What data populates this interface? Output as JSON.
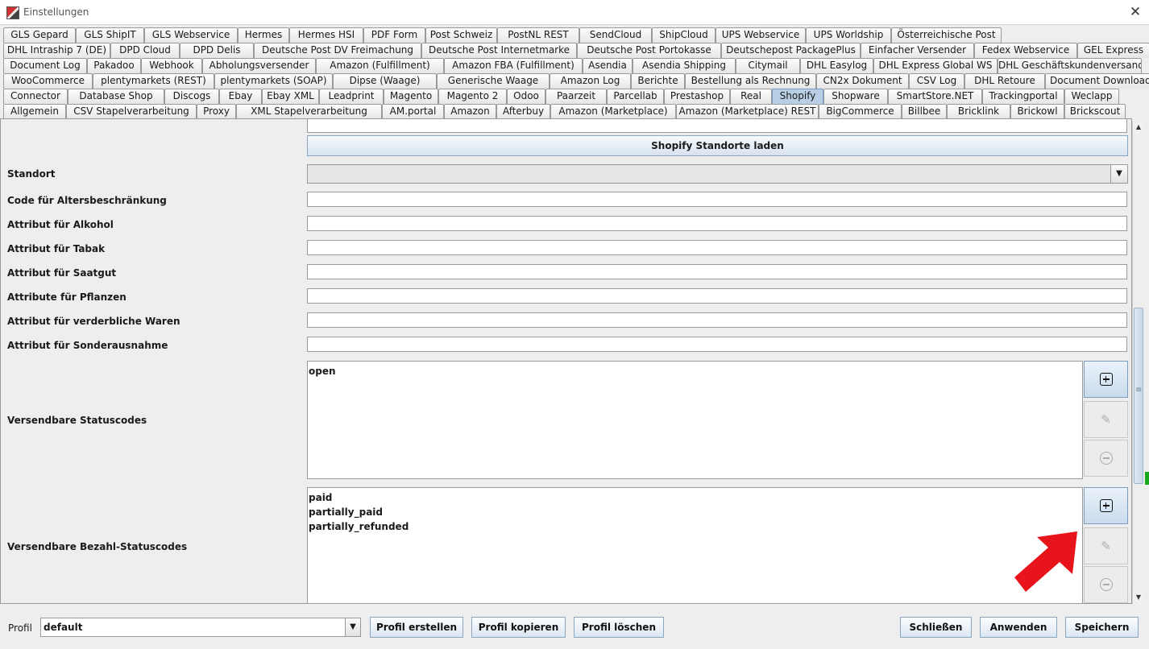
{
  "window": {
    "title": "Einstellungen"
  },
  "tab_rows": [
    [
      "GLS Gepard",
      "GLS ShipIT",
      "GLS Webservice",
      "Hermes",
      "Hermes HSI",
      "PDF Form",
      "Post Schweiz",
      "PostNL REST",
      "SendCloud",
      "ShipCloud",
      "UPS Webservice",
      "UPS Worldship",
      "Österreichische Post"
    ],
    [
      "DHL Intraship 7 (DE)",
      "DPD Cloud",
      "DPD Delis",
      "Deutsche Post DV Freimachung",
      "Deutsche Post Internetmarke",
      "Deutsche Post Portokasse",
      "Deutschepost PackagePlus",
      "Einfacher Versender",
      "Fedex Webservice",
      "GEL Express"
    ],
    [
      "Document Log",
      "Pakadoo",
      "Webhook",
      "Abholungsversender",
      "Amazon (Fulfillment)",
      "Amazon FBA (Fulfillment)",
      "Asendia",
      "Asendia Shipping",
      "Citymail",
      "DHL Easylog",
      "DHL Express Global WS",
      "DHL Geschäftskundenversand"
    ],
    [
      "WooCommerce",
      "plentymarkets (REST)",
      "plentymarkets (SOAP)",
      "Dipse (Waage)",
      "Generische Waage",
      "Amazon Log",
      "Berichte",
      "Bestellung als Rechnung",
      "CN2x Dokument",
      "CSV Log",
      "DHL Retoure",
      "Document Downloader"
    ],
    [
      "Connector",
      "Database Shop",
      "Discogs",
      "Ebay",
      "Ebay XML",
      "Leadprint",
      "Magento",
      "Magento 2",
      "Odoo",
      "Paarzeit",
      "Parcellab",
      "Prestashop",
      "Real",
      "Shopify",
      "Shopware",
      "SmartStore.NET",
      "Trackingportal",
      "Weclapp"
    ],
    [
      "Allgemein",
      "CSV Stapelverarbeitung",
      "Proxy",
      "XML Stapelverarbeitung",
      "AM.portal",
      "Amazon",
      "Afterbuy",
      "Amazon (Marketplace)",
      "Amazon (Marketplace) REST",
      "BigCommerce",
      "Billbee",
      "Bricklink",
      "Brickowl",
      "Brickscout"
    ]
  ],
  "active_tab": "Shopify",
  "form": {
    "load_locations_button": "Shopify Standorte laden",
    "location_label": "Standort",
    "location_value": "",
    "fields": [
      {
        "label": "Code für Altersbeschränkung",
        "value": ""
      },
      {
        "label": "Attribut für Alkohol",
        "value": ""
      },
      {
        "label": "Attribut für Tabak",
        "value": ""
      },
      {
        "label": "Attribut für Saatgut",
        "value": ""
      },
      {
        "label": "Attribute für Pflanzen",
        "value": ""
      },
      {
        "label": "Attribut für verderbliche Waren",
        "value": ""
      },
      {
        "label": "Attribut für Sonderausnahme",
        "value": ""
      }
    ],
    "status_codes": {
      "label": "Versendbare Statuscodes",
      "items": [
        "open"
      ]
    },
    "payment_status_codes": {
      "label": "Versendbare Bezahl-Statuscodes",
      "items": [
        "paid",
        "partially_paid",
        "partially_refunded"
      ]
    }
  },
  "icons": {
    "add": "plus-square-icon",
    "edit": "pencil-icon",
    "remove": "minus-circle-icon",
    "annotation": "red-arrow-annotation"
  },
  "colors": {
    "active_tab": "#b8cfe5",
    "annotation_arrow": "#e8141b"
  },
  "footer": {
    "profile_label": "Profil",
    "profile_value": "default",
    "create_button": "Profil erstellen",
    "copy_button": "Profil kopieren",
    "delete_button": "Profil löschen",
    "close_button": "Schließen",
    "apply_button": "Anwenden",
    "save_button": "Speichern"
  }
}
